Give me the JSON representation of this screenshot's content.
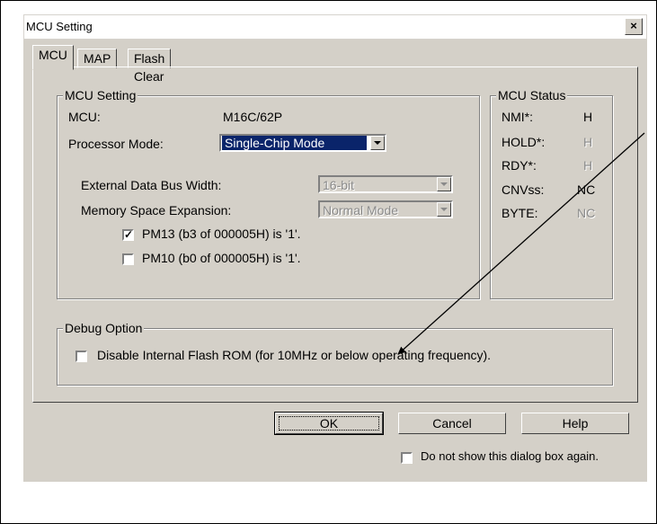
{
  "dialog": {
    "title": "MCU Setting",
    "close_glyph": "×",
    "tabs": [
      {
        "label": "MCU"
      },
      {
        "label": "MAP"
      },
      {
        "label": "Flash Clear"
      }
    ],
    "mcu_setting": {
      "legend": "MCU Setting",
      "mcu_label": "MCU:",
      "mcu_value": "M16C/62P",
      "processor_mode_label": "Processor Mode:",
      "processor_mode_value": "Single-Chip Mode",
      "ext_bus_label": "External Data Bus Width:",
      "ext_bus_value": "16-bit",
      "mem_exp_label": "Memory Space Expansion:",
      "mem_exp_value": "Normal Mode",
      "pm13_label": "PM13 (b3 of 000005H) is '1'.",
      "pm13_checked": true,
      "pm10_label": "PM10 (b0 of 000005H) is '1'.",
      "pm10_checked": false
    },
    "mcu_status": {
      "legend": "MCU Status",
      "rows": [
        {
          "name": "NMI*:",
          "value": "H"
        },
        {
          "name": "HOLD*:",
          "value": "H"
        },
        {
          "name": "RDY*:",
          "value": "H"
        },
        {
          "name": "CNVss:",
          "value": "NC"
        },
        {
          "name": "BYTE:",
          "value": "NC"
        }
      ]
    },
    "debug_option": {
      "legend": "Debug Option",
      "disable_flash_label": "Disable Internal Flash ROM (for 10MHz or below operating frequency).",
      "disable_flash_checked": false
    },
    "buttons": {
      "ok": "OK",
      "cancel": "Cancel",
      "help": "Help"
    },
    "dont_show_label": "Do not show this dialog box again.",
    "dont_show_checked": false
  },
  "colors": {
    "face": "#d4d0c8",
    "selection": "#0a246a",
    "disabled": "#8a8a8a"
  }
}
